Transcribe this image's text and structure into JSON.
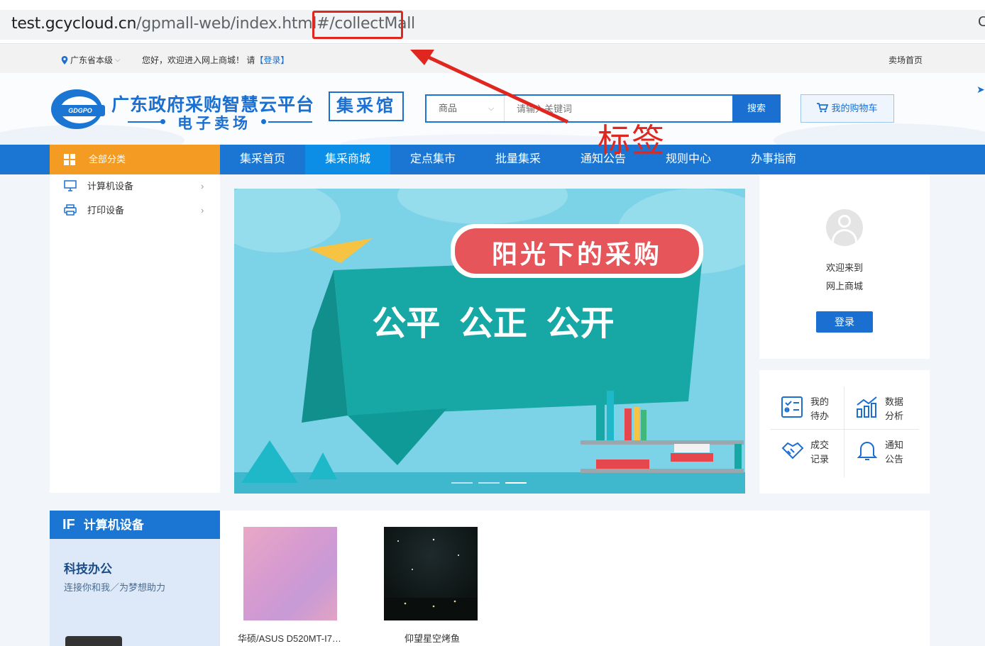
{
  "browser": {
    "url_host": "test.gcycloud.cn",
    "url_path_mid": "/gpmall-web/index.html#/",
    "url_fragment": "collectMall",
    "extra_icon": "C"
  },
  "topbar": {
    "location": "广东省本级",
    "welcome": "您好，欢迎进入网上商城！ 请",
    "login_link": "【登录】",
    "home_link": "卖场首页"
  },
  "header": {
    "logo_text": "GDGPO",
    "title": "广东政府采购智慧云平台",
    "subtitle": "电子卖场",
    "hall_label": "集采馆",
    "search_category": "商品",
    "search_placeholder": "请输入关键词",
    "search_button": "搜索",
    "cart_label": "我的购物车"
  },
  "nav": {
    "all_categories": "全部分类",
    "items": [
      "集采首页",
      "集采商城",
      "定点集市",
      "批量集采",
      "通知公告",
      "规则中心",
      "办事指南"
    ],
    "active_index": 1
  },
  "categories": [
    {
      "label": "计算机设备",
      "icon": "monitor-icon"
    },
    {
      "label": "打印设备",
      "icon": "printer-icon"
    }
  ],
  "banner": {
    "headline": "阳光下的采购",
    "slogan": "公平  公正  公开",
    "slide_count": 3,
    "active_slide": 3
  },
  "user_card": {
    "welcome_line1": "欢迎来到",
    "welcome_line2": "网上商城",
    "login_button": "登录"
  },
  "tools": [
    {
      "label1": "我的",
      "label2": "待办",
      "icon": "todo-list-icon"
    },
    {
      "label1": "数据",
      "label2": "分析",
      "icon": "bar-chart-icon"
    },
    {
      "label1": "成交",
      "label2": "记录",
      "icon": "handshake-icon"
    },
    {
      "label1": "通知",
      "label2": "公告",
      "icon": "bell-icon"
    }
  ],
  "floor": {
    "badge": "IF",
    "title": "计算机设备",
    "side_title": "科技办公",
    "side_subtitle": "连接你和我／为梦想助力"
  },
  "products": [
    {
      "name": "华硕/ASUS D520MT-I7…"
    },
    {
      "name": "仰望星空烤鱼"
    }
  ],
  "annotation": {
    "label": "标签"
  },
  "colors": {
    "primary": "#1a76d2",
    "accent_orange": "#f39b22",
    "annotation_red": "#e0271f"
  }
}
